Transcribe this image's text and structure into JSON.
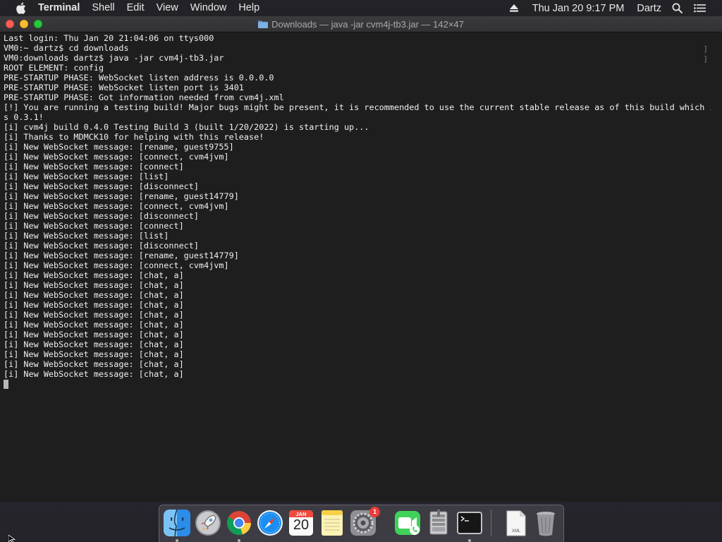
{
  "menubar": {
    "apple_icon": "apple-logo-icon",
    "app_name": "Terminal",
    "items": [
      "Shell",
      "Edit",
      "View",
      "Window",
      "Help"
    ],
    "clock": "Thu Jan 20  9:17 PM",
    "user": "Dartz",
    "status_icons": [
      "eject-icon",
      "spotlight-search-icon",
      "control-center-icon"
    ]
  },
  "window": {
    "title": "Downloads — java -jar cvm4j-tb3.jar — 142×47",
    "title_icon": "folder-icon",
    "lines": [
      "Last login: Thu Jan 20 21:04:06 on ttys000",
      "VM0:~ dartz$ cd downloads",
      "VM0:downloads dartz$ java -jar cvm4j-tb3.jar",
      "ROOT ELEMENT: config",
      "PRE-STARTUP PHASE: WebSocket listen address is 0.0.0.0",
      "PRE-STARTUP PHASE: WebSocket listen port is 3401",
      "PRE-STARTUP PHASE: Got information needed from cvm4j.xml",
      "[!] You are running a testing build! Major bugs might be present, it is recommended to use the current stable release as of this build which i",
      "s 0.3.1!",
      "[i] cvm4j build 0.4.0 Testing Build 3 (built 1/20/2022) is starting up...",
      "[i] Thanks to MDMCK10 for helping with this release!",
      "[i] New WebSocket message: [rename, guest9755]",
      "[i] New WebSocket message: [connect, cvm4jvm]",
      "[i] New WebSocket message: [connect]",
      "[i] New WebSocket message: [list]",
      "[i] New WebSocket message: [disconnect]",
      "[i] New WebSocket message: [rename, guest14779]",
      "[i] New WebSocket message: [connect, cvm4jvm]",
      "[i] New WebSocket message: [disconnect]",
      "[i] New WebSocket message: [connect]",
      "[i] New WebSocket message: [list]",
      "[i] New WebSocket message: [disconnect]",
      "[i] New WebSocket message: [rename, guest14779]",
      "[i] New WebSocket message: [connect, cvm4jvm]",
      "[i] New WebSocket message: [chat, a]",
      "[i] New WebSocket message: [chat, a]",
      "[i] New WebSocket message: [chat, a]",
      "[i] New WebSocket message: [chat, a]",
      "[i] New WebSocket message: [chat, a]",
      "[i] New WebSocket message: [chat, a]",
      "[i] New WebSocket message: [chat, a]",
      "[i] New WebSocket message: [chat, a]",
      "[i] New WebSocket message: [chat, a]",
      "[i] New WebSocket message: [chat, a]",
      "[i] New WebSocket message: [chat, a]"
    ]
  },
  "dock": {
    "items": [
      {
        "name": "finder-icon",
        "running": true
      },
      {
        "name": "launchpad-icon",
        "running": false
      },
      {
        "name": "chrome-icon",
        "running": true
      },
      {
        "name": "safari-icon",
        "running": false
      },
      {
        "name": "calendar-icon",
        "running": false,
        "month": "JAN",
        "day": "20"
      },
      {
        "name": "notes-icon",
        "running": false
      },
      {
        "name": "system-preferences-icon",
        "running": false,
        "badge": "1"
      },
      {
        "name": "facetime-icon",
        "running": false
      },
      {
        "name": "disk-utility-icon",
        "running": false
      },
      {
        "name": "terminal-icon",
        "running": true
      },
      {
        "name": "xml-file-icon",
        "running": false
      },
      {
        "name": "trash-icon",
        "running": false
      }
    ]
  }
}
